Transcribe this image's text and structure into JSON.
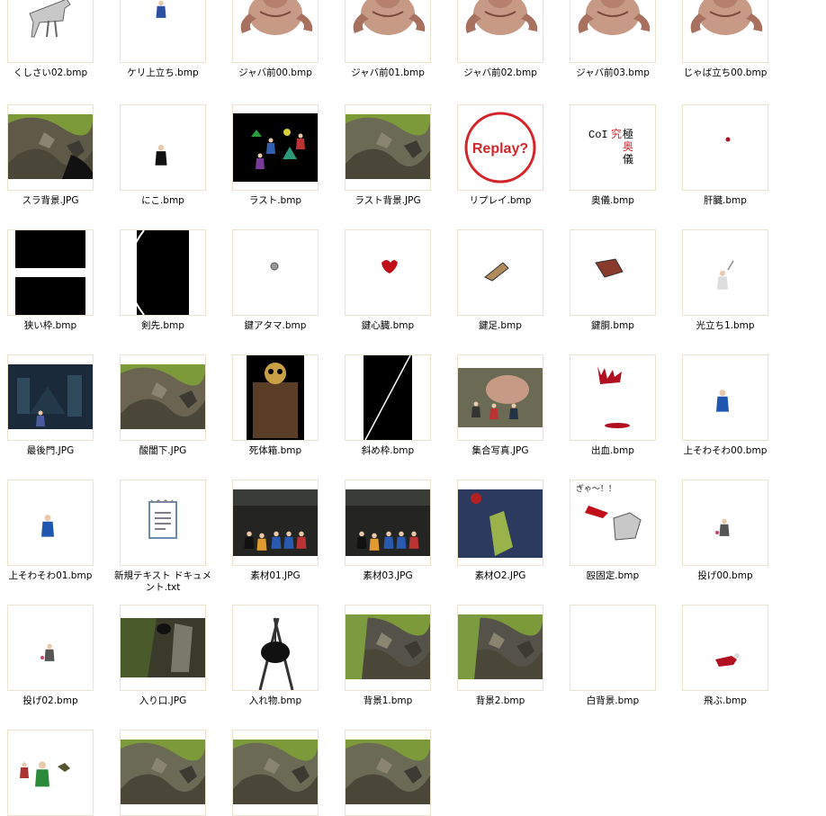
{
  "folder": {
    "files": [
      {
        "name": "くしさい02.bmp",
        "icon": "horse-sprite"
      },
      {
        "name": "ケリ上立ち.bmp",
        "icon": "blue-figure-sprite"
      },
      {
        "name": "ジャバ前00.bmp",
        "icon": "fat-monster"
      },
      {
        "name": "ジャバ前01.bmp",
        "icon": "fat-monster"
      },
      {
        "name": "ジャバ前02.bmp",
        "icon": "fat-monster"
      },
      {
        "name": "ジャバ前03.bmp",
        "icon": "fat-monster"
      },
      {
        "name": "じゃば立ち00.bmp",
        "icon": "fat-monster"
      },
      {
        "name": "スラ背景.JPG",
        "icon": "terrain-dark"
      },
      {
        "name": "にこ.bmp",
        "icon": "black-figure-sprite"
      },
      {
        "name": "ラスト.bmp",
        "icon": "last-scene"
      },
      {
        "name": "ラスト背景.JPG",
        "icon": "terrain-grass"
      },
      {
        "name": "リプレイ.bmp",
        "icon": "replay-circle",
        "text": "Replay?"
      },
      {
        "name": "奥儀.bmp",
        "icon": "okugi-text",
        "text": "CoI究極奥儀"
      },
      {
        "name": "肝臓.bmp",
        "icon": "small-red-dot"
      },
      {
        "name": "狭い枠.bmp",
        "icon": "narrow-frame"
      },
      {
        "name": "剣先.bmp",
        "icon": "sword-tip"
      },
      {
        "name": "鍵アタマ.bmp",
        "icon": "small-grey-dot"
      },
      {
        "name": "鍵心臓.bmp",
        "icon": "red-heart"
      },
      {
        "name": "鍵足.bmp",
        "icon": "leg-sprite"
      },
      {
        "name": "鍵胴.bmp",
        "icon": "torso-sprite"
      },
      {
        "name": "光立ち1.bmp",
        "icon": "white-figure-sprite"
      },
      {
        "name": "最後門.JPG",
        "icon": "castle-gate"
      },
      {
        "name": "酸闇下.JPG",
        "icon": "terrain-rock"
      },
      {
        "name": "死体箱.bmp",
        "icon": "coffin"
      },
      {
        "name": "斜め枠.bmp",
        "icon": "diagonal-frame"
      },
      {
        "name": "集合写真.JPG",
        "icon": "group-photo"
      },
      {
        "name": "出血.bmp",
        "icon": "blood-splatter"
      },
      {
        "name": "上そわそわ00.bmp",
        "icon": "blue-robe-sprite"
      },
      {
        "name": "上そわそわ01.bmp",
        "icon": "blue-robe-sprite"
      },
      {
        "name": "新規テキスト ドキュメント.txt",
        "icon": "notepad-icon"
      },
      {
        "name": "素材01.JPG",
        "icon": "characters-scene"
      },
      {
        "name": "素材03.JPG",
        "icon": "characters-scene"
      },
      {
        "name": "素材O2.JPG",
        "icon": "blue-cave"
      },
      {
        "name": "殴固定.bmp",
        "icon": "attack-scene",
        "text": "ぎゃ～！！"
      },
      {
        "name": "投げ00.bmp",
        "icon": "small-figure-sprite"
      },
      {
        "name": "投げ02.bmp",
        "icon": "small-figure-sprite"
      },
      {
        "name": "入り口.JPG",
        "icon": "forest-entrance"
      },
      {
        "name": "入れ物.bmp",
        "icon": "cauldron"
      },
      {
        "name": "背景1.bmp",
        "icon": "terrain-cliff"
      },
      {
        "name": "背景2.bmp",
        "icon": "terrain-cliff"
      },
      {
        "name": "白背景.bmp",
        "icon": "blank-white"
      },
      {
        "name": "飛ぶ.bmp",
        "icon": "flying-sprite"
      },
      {
        "name": "",
        "icon": "green-scene"
      },
      {
        "name": "",
        "icon": "terrain-grass"
      },
      {
        "name": "",
        "icon": "terrain-grass"
      },
      {
        "name": "",
        "icon": "terrain-grass"
      }
    ]
  }
}
